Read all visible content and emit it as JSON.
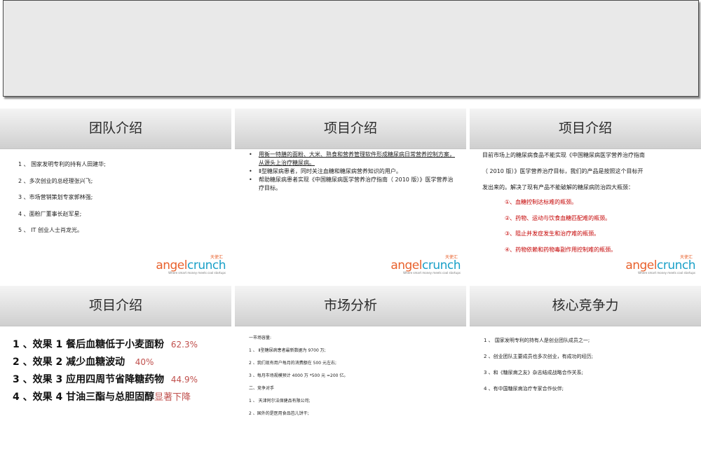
{
  "logo": {
    "cn": "天使汇",
    "brand_a": "angel",
    "brand_c": "crunch",
    "tagline": "Where smart money meets cool startups"
  },
  "slides": [
    {
      "title": "团队介绍",
      "items": [
        "1 、 国家发明专利的持有人田建华;",
        "2 、多次创业的总经理张兴飞;",
        "3 、市场营销策划专家郭林强;",
        "4 、面粉厂董事长赵军星;",
        "5 、 IT 创业人士肖龙光。"
      ]
    },
    {
      "title": "项目介绍",
      "bullets": [
        "用衡一特膳的面粉、大米、熟食和营养管理软件形成糖尿病日常营养控制方案，从源头上治疗糖尿病。",
        "Ⅱ型糖尿病患者，同时关注血糖和糖尿病营养知识的用户。",
        "帮助糖尿病患者实现《中国糖尿病医学营养治疗指南（ 2010 版）》医学营养治疗目标。"
      ]
    },
    {
      "title": "项目介绍",
      "intro": [
        "目前市场上的糖尿病食品不能实现《中国糖尿病医学营养治疗指南",
        "（ 2010 版）》医学营养治疗目标，我们的产品是按照这个目标开",
        "发出来的。解决了现有产品不能破解的糖尿病防治四大瓶颈："
      ],
      "points": [
        "①、血糖控制达标难的瓶颈。",
        "②、药物、运动与饮食血糖匹配难的瓶颈。",
        "③、阻止并发症发生和治疗难的瓶颈。",
        "④、药物依赖和药物毒副作用控制难的瓶颈。"
      ]
    },
    {
      "title": "项目介绍",
      "effects": [
        {
          "text": "1 、效果 1 餐后血糖低于小麦面粉",
          "value": "62.3%"
        },
        {
          "text": "2 、效果 2 减少血糖波动",
          "value": "40%"
        },
        {
          "text": "3 、效果 3 应用四周节省降糖药物",
          "value": "44.9%"
        },
        {
          "text": "4 、效果 4 甘油三酯与总胆固醇",
          "value": "显著下降"
        }
      ]
    },
    {
      "title": "市场分析",
      "lines": [
        "一市场容量:",
        "1 、 Ⅱ型糖尿病患者最新数据为 9700 万;",
        "2 、我们现有用户每月的消费额在 500 元左右;",
        "3 、每月市场规模预计 4000 万 *500 元 =200 亿。",
        "二、竞争对手",
        "1 、 天津阿尔法保健品有限公司;",
        "2 、国外的是医用食品芭儿饼干;"
      ]
    },
    {
      "title": "核心竞争力",
      "items": [
        "1 、 国家发明专利的持有人是创业团队成员之一;",
        "2 、创业团队主要成员也多次创业，有成功的经历;",
        "3 、和《糖尿病之友》杂志结成战略合作关系;",
        "4 、有中国糖尿病治疗专家合作伙伴;"
      ]
    }
  ]
}
